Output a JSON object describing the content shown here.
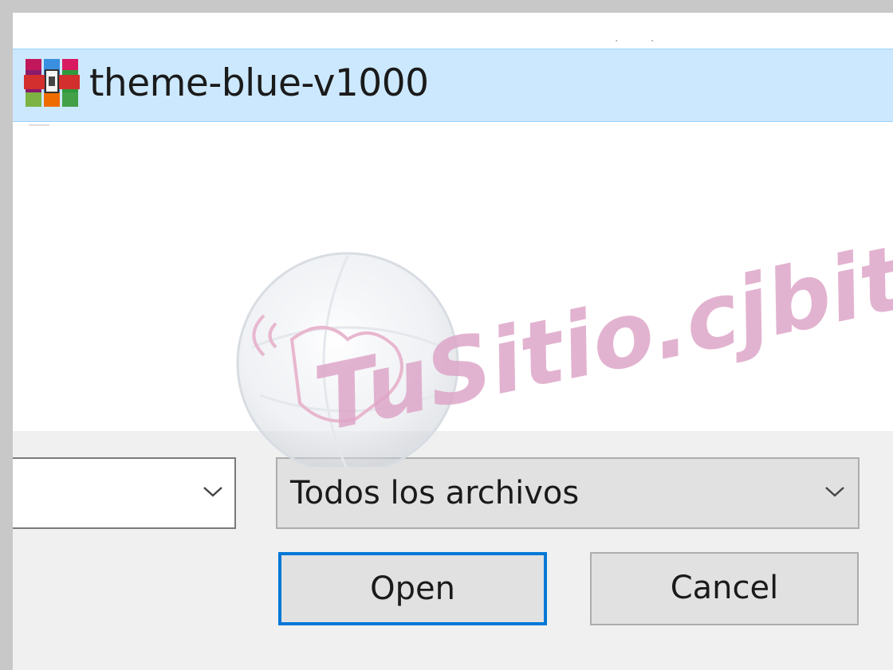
{
  "file_list": {
    "items": [
      {
        "name": "theme-blue-v1000",
        "icon": "winrar-archive-icon",
        "selected": true
      }
    ]
  },
  "bottom_panel": {
    "filename_value": "",
    "file_type": {
      "selected": "Todos los archivos"
    },
    "open_label": "Open",
    "cancel_label": "Cancel"
  },
  "watermark": {
    "text": "TuSitio.cjbit.co"
  },
  "colors": {
    "selection_bg": "#cce8ff",
    "selection_border": "#99d1ff",
    "focus_border": "#0078d7",
    "panel_bg": "#f0f0f0",
    "button_bg": "#e1e1e1",
    "watermark": "#dda6c8"
  }
}
